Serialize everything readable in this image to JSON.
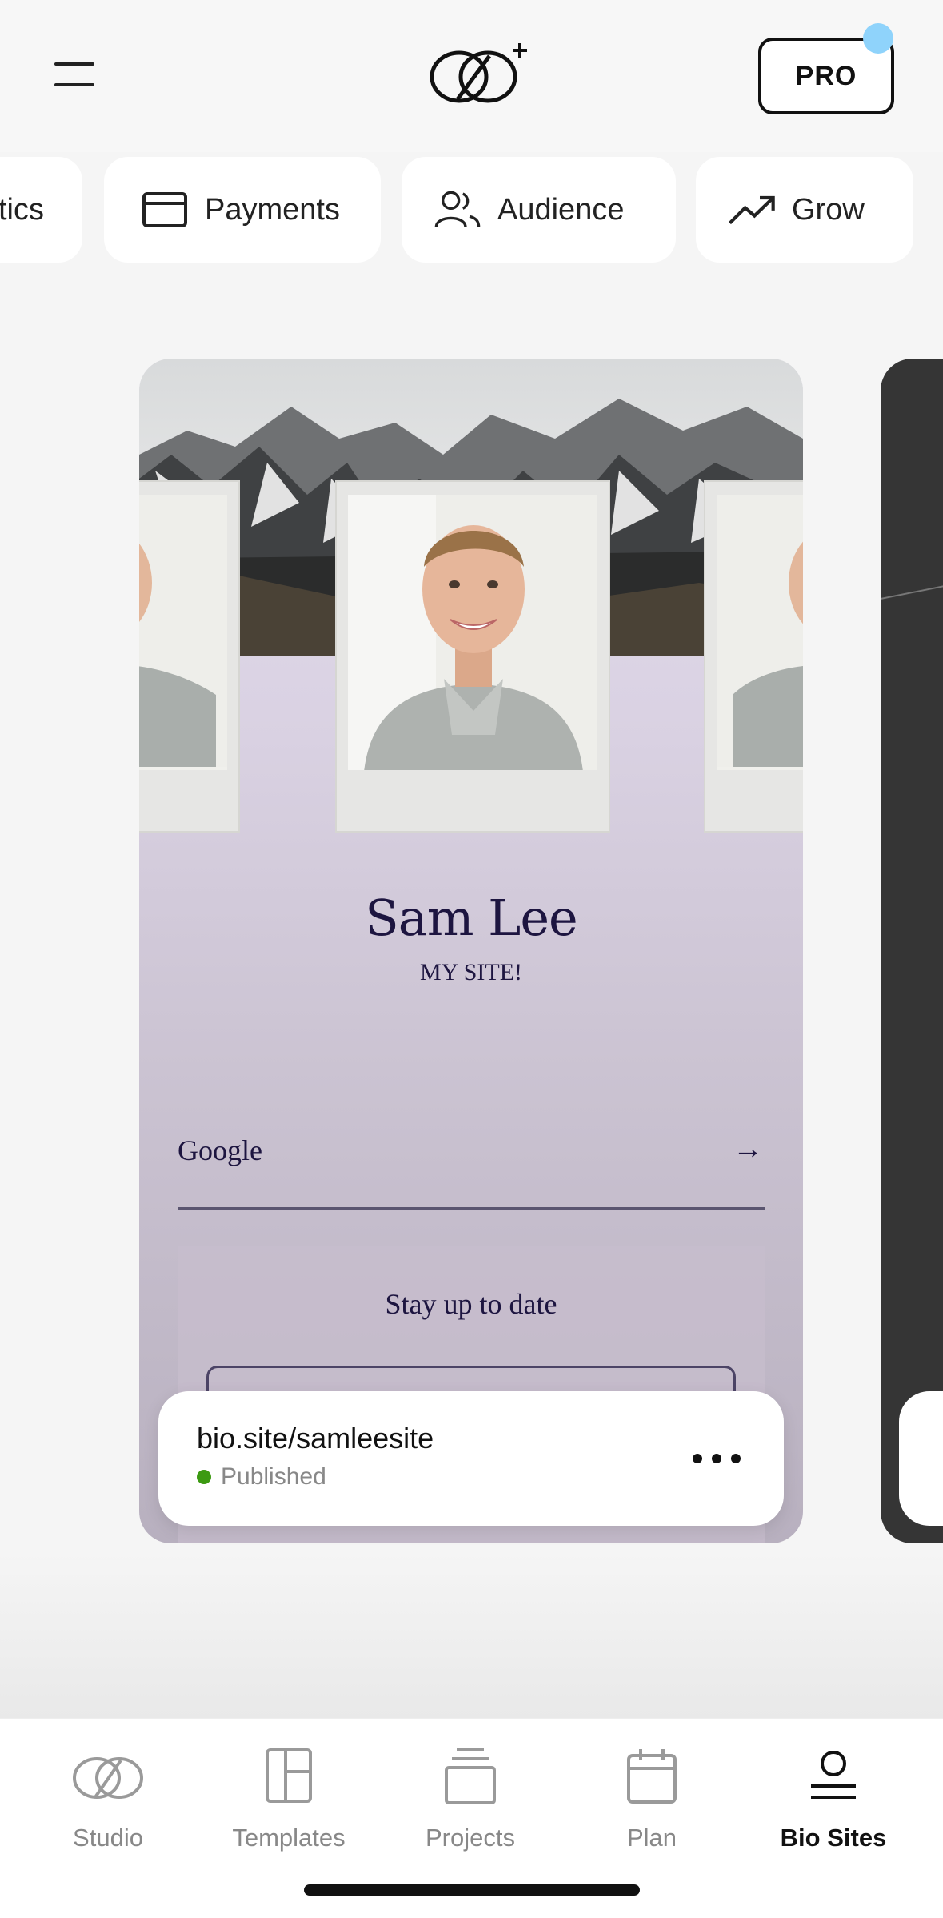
{
  "header": {
    "pro_label": "PRO"
  },
  "chips": [
    {
      "label": "tics",
      "icon": "analytics-icon"
    },
    {
      "label": "Payments",
      "icon": "credit-card-icon"
    },
    {
      "label": "Audience",
      "icon": "users-icon"
    },
    {
      "label": "Grow",
      "icon": "trending-up-icon"
    }
  ],
  "site_card": {
    "name": "Sam Lee",
    "subtitle": "MY SITE!",
    "link_label": "Google",
    "link_arrow": "→",
    "signup_title": "Stay up to date"
  },
  "site_pill": {
    "url": "bio.site/samleesite",
    "status": "Published",
    "status_color": "#3c9a12"
  },
  "pager": {
    "total": 2,
    "active": 1
  },
  "tabbar": {
    "items": [
      {
        "label": "Studio",
        "icon": "studio-icon",
        "active": false
      },
      {
        "label": "Templates",
        "icon": "templates-icon",
        "active": false
      },
      {
        "label": "Projects",
        "icon": "projects-icon",
        "active": false
      },
      {
        "label": "Plan",
        "icon": "calendar-icon",
        "active": false
      },
      {
        "label": "Bio Sites",
        "icon": "bio-sites-icon",
        "active": true
      }
    ]
  },
  "colors": {
    "pro_dot": "#8fd3fb",
    "card_text": "#1d1540"
  }
}
